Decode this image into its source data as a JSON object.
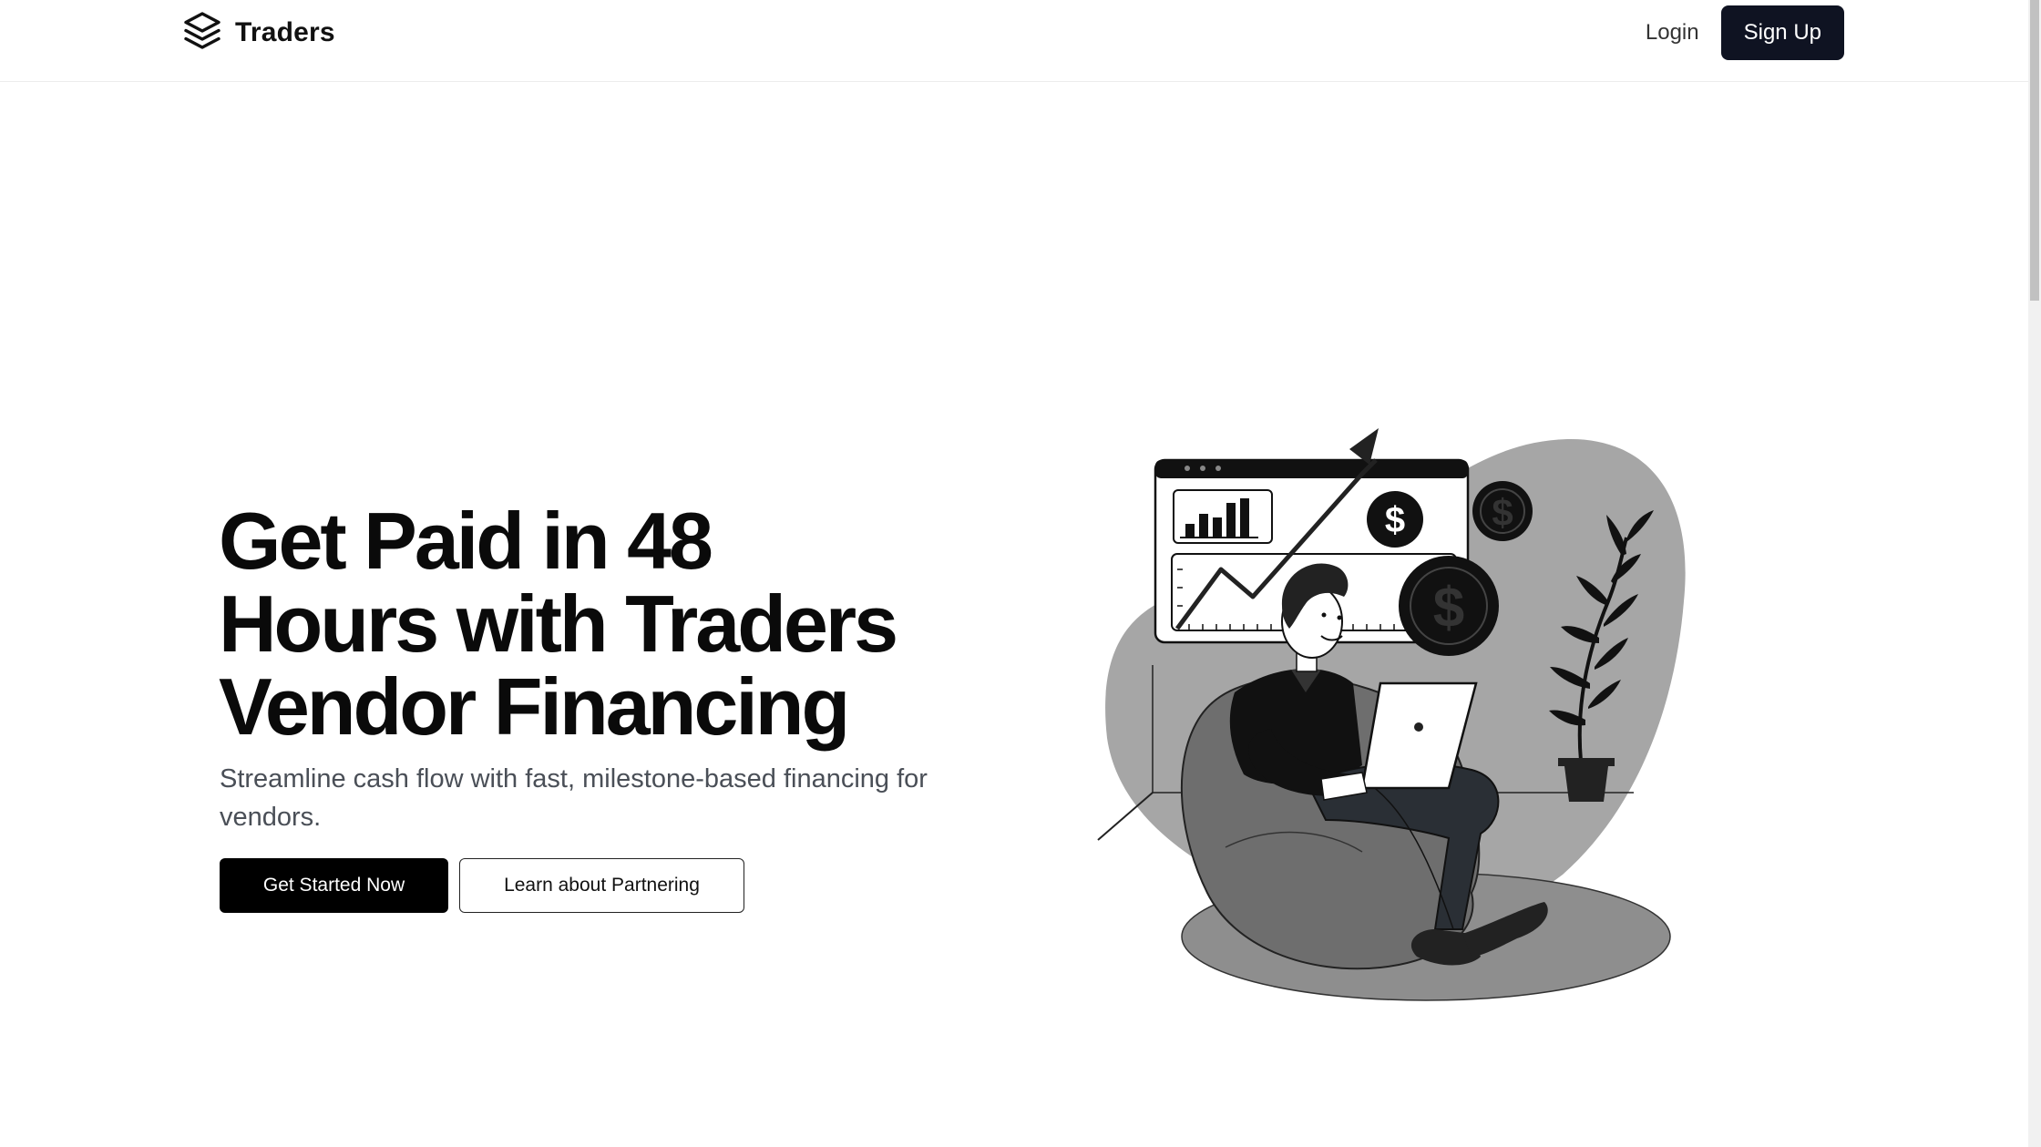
{
  "header": {
    "brand": "Traders",
    "login_label": "Login",
    "signup_label": "Sign Up"
  },
  "hero": {
    "title": "Get Paid in 48 Hours with Traders Vendor Financing",
    "subtitle": "Streamline cash flow with fast, milestone-based financing for vendors.",
    "primary_cta": "Get Started Now",
    "secondary_cta": "Learn about Partnering"
  },
  "icons": {
    "logo": "layers-icon",
    "illustration": "man-on-beanbag-with-laptop-and-growth-chart"
  },
  "colors": {
    "signup_bg": "#0f1322",
    "primary_btn_bg": "#000000",
    "subtitle_text": "#4a4f57"
  }
}
